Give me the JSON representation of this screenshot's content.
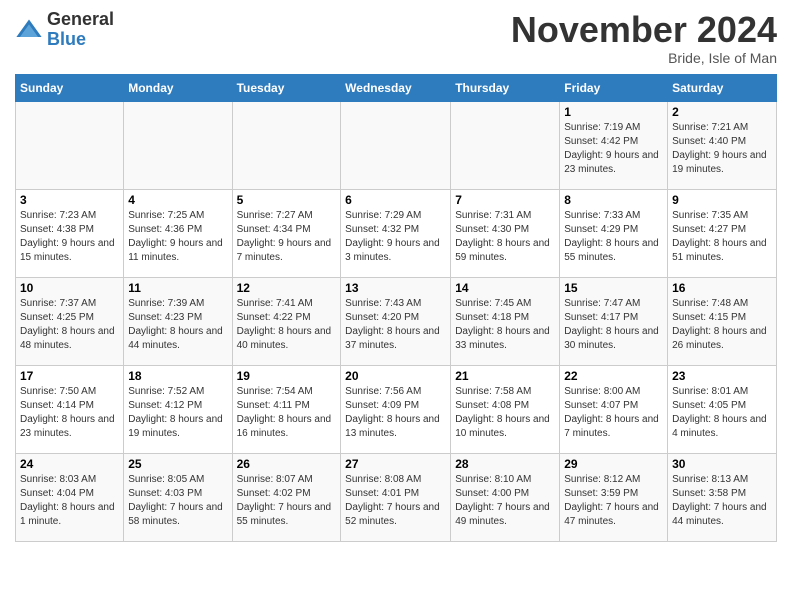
{
  "logo": {
    "general": "General",
    "blue": "Blue"
  },
  "header": {
    "month": "November 2024",
    "location": "Bride, Isle of Man"
  },
  "days_of_week": [
    "Sunday",
    "Monday",
    "Tuesday",
    "Wednesday",
    "Thursday",
    "Friday",
    "Saturday"
  ],
  "weeks": [
    [
      {
        "day": "",
        "info": ""
      },
      {
        "day": "",
        "info": ""
      },
      {
        "day": "",
        "info": ""
      },
      {
        "day": "",
        "info": ""
      },
      {
        "day": "",
        "info": ""
      },
      {
        "day": "1",
        "info": "Sunrise: 7:19 AM\nSunset: 4:42 PM\nDaylight: 9 hours and 23 minutes."
      },
      {
        "day": "2",
        "info": "Sunrise: 7:21 AM\nSunset: 4:40 PM\nDaylight: 9 hours and 19 minutes."
      }
    ],
    [
      {
        "day": "3",
        "info": "Sunrise: 7:23 AM\nSunset: 4:38 PM\nDaylight: 9 hours and 15 minutes."
      },
      {
        "day": "4",
        "info": "Sunrise: 7:25 AM\nSunset: 4:36 PM\nDaylight: 9 hours and 11 minutes."
      },
      {
        "day": "5",
        "info": "Sunrise: 7:27 AM\nSunset: 4:34 PM\nDaylight: 9 hours and 7 minutes."
      },
      {
        "day": "6",
        "info": "Sunrise: 7:29 AM\nSunset: 4:32 PM\nDaylight: 9 hours and 3 minutes."
      },
      {
        "day": "7",
        "info": "Sunrise: 7:31 AM\nSunset: 4:30 PM\nDaylight: 8 hours and 59 minutes."
      },
      {
        "day": "8",
        "info": "Sunrise: 7:33 AM\nSunset: 4:29 PM\nDaylight: 8 hours and 55 minutes."
      },
      {
        "day": "9",
        "info": "Sunrise: 7:35 AM\nSunset: 4:27 PM\nDaylight: 8 hours and 51 minutes."
      }
    ],
    [
      {
        "day": "10",
        "info": "Sunrise: 7:37 AM\nSunset: 4:25 PM\nDaylight: 8 hours and 48 minutes."
      },
      {
        "day": "11",
        "info": "Sunrise: 7:39 AM\nSunset: 4:23 PM\nDaylight: 8 hours and 44 minutes."
      },
      {
        "day": "12",
        "info": "Sunrise: 7:41 AM\nSunset: 4:22 PM\nDaylight: 8 hours and 40 minutes."
      },
      {
        "day": "13",
        "info": "Sunrise: 7:43 AM\nSunset: 4:20 PM\nDaylight: 8 hours and 37 minutes."
      },
      {
        "day": "14",
        "info": "Sunrise: 7:45 AM\nSunset: 4:18 PM\nDaylight: 8 hours and 33 minutes."
      },
      {
        "day": "15",
        "info": "Sunrise: 7:47 AM\nSunset: 4:17 PM\nDaylight: 8 hours and 30 minutes."
      },
      {
        "day": "16",
        "info": "Sunrise: 7:48 AM\nSunset: 4:15 PM\nDaylight: 8 hours and 26 minutes."
      }
    ],
    [
      {
        "day": "17",
        "info": "Sunrise: 7:50 AM\nSunset: 4:14 PM\nDaylight: 8 hours and 23 minutes."
      },
      {
        "day": "18",
        "info": "Sunrise: 7:52 AM\nSunset: 4:12 PM\nDaylight: 8 hours and 19 minutes."
      },
      {
        "day": "19",
        "info": "Sunrise: 7:54 AM\nSunset: 4:11 PM\nDaylight: 8 hours and 16 minutes."
      },
      {
        "day": "20",
        "info": "Sunrise: 7:56 AM\nSunset: 4:09 PM\nDaylight: 8 hours and 13 minutes."
      },
      {
        "day": "21",
        "info": "Sunrise: 7:58 AM\nSunset: 4:08 PM\nDaylight: 8 hours and 10 minutes."
      },
      {
        "day": "22",
        "info": "Sunrise: 8:00 AM\nSunset: 4:07 PM\nDaylight: 8 hours and 7 minutes."
      },
      {
        "day": "23",
        "info": "Sunrise: 8:01 AM\nSunset: 4:05 PM\nDaylight: 8 hours and 4 minutes."
      }
    ],
    [
      {
        "day": "24",
        "info": "Sunrise: 8:03 AM\nSunset: 4:04 PM\nDaylight: 8 hours and 1 minute."
      },
      {
        "day": "25",
        "info": "Sunrise: 8:05 AM\nSunset: 4:03 PM\nDaylight: 7 hours and 58 minutes."
      },
      {
        "day": "26",
        "info": "Sunrise: 8:07 AM\nSunset: 4:02 PM\nDaylight: 7 hours and 55 minutes."
      },
      {
        "day": "27",
        "info": "Sunrise: 8:08 AM\nSunset: 4:01 PM\nDaylight: 7 hours and 52 minutes."
      },
      {
        "day": "28",
        "info": "Sunrise: 8:10 AM\nSunset: 4:00 PM\nDaylight: 7 hours and 49 minutes."
      },
      {
        "day": "29",
        "info": "Sunrise: 8:12 AM\nSunset: 3:59 PM\nDaylight: 7 hours and 47 minutes."
      },
      {
        "day": "30",
        "info": "Sunrise: 8:13 AM\nSunset: 3:58 PM\nDaylight: 7 hours and 44 minutes."
      }
    ]
  ]
}
